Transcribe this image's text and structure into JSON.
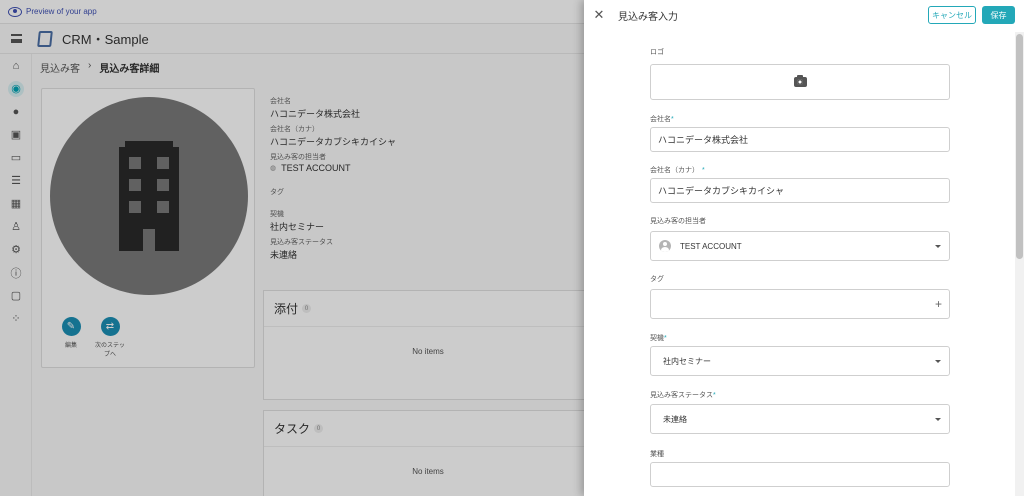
{
  "preview_bar": {
    "text": "Preview of your app"
  },
  "app": {
    "title": "CRM・Sample"
  },
  "sidebar": {
    "icons": [
      "home-icon",
      "prospect-icon",
      "account-circle-icon",
      "contact-icon",
      "chat-icon",
      "list-icon",
      "calendar-icon",
      "person-edit-icon",
      "settings-icon",
      "info-icon",
      "feedback-icon",
      "apps-icon"
    ],
    "active_index": 1
  },
  "breadcrumb": {
    "parent": "見込み客",
    "separator": "›",
    "current": "見込み客詳細"
  },
  "actions": {
    "edit_label": "編集",
    "next_step_label": "次のステッ\nプへ"
  },
  "info": {
    "company_label": "会社名",
    "company_value": "ハコニデータ株式会社",
    "kana_label": "会社名（カナ）",
    "kana_value": "ハコニデータカブシキカイシャ",
    "owner_label": "見込み客の担当者",
    "owner_value": "TEST ACCOUNT",
    "tag_label": "タグ",
    "opportunity_label": "契機",
    "opportunity_value": "社内セミナー",
    "status_label": "見込み客ステータス",
    "status_value": "未連絡"
  },
  "panels": {
    "attachments": {
      "title": "添付",
      "count": "0",
      "empty": "No items"
    },
    "tasks": {
      "title": "タスク",
      "count": "0",
      "empty": "No items"
    }
  },
  "drawer": {
    "title": "見込み客入力",
    "cancel_label": "キャンセル",
    "save_label": "保存",
    "fields": {
      "logo_label": "ロゴ",
      "company_label": "会社名",
      "company_value": "ハコニデータ株式会社",
      "kana_label": "会社名（カナ）",
      "kana_value": "ハコニデータカブシキカイシャ",
      "owner_label": "見込み客の担当者",
      "owner_value": "TEST ACCOUNT",
      "tag_label": "タグ",
      "opportunity_label": "契機",
      "opportunity_value": "社内セミナー",
      "status_label": "見込み客ステータス",
      "status_value": "未連絡",
      "industry_label": "業種",
      "industry_value": ""
    },
    "required_mark": "*"
  },
  "colors": {
    "accent": "#23a8b8",
    "primary_btn": "#1b8fb5"
  }
}
